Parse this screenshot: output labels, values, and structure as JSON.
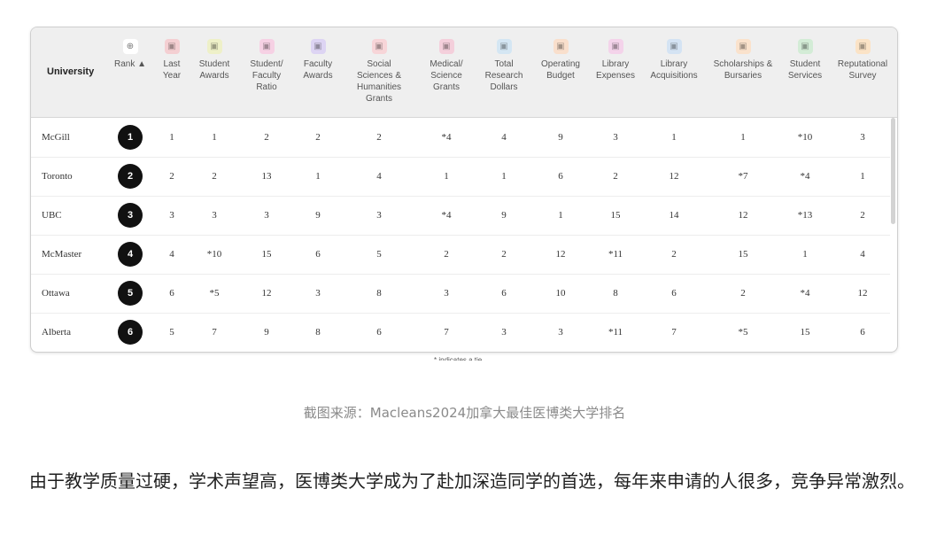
{
  "table": {
    "university_header": "University",
    "columns": [
      {
        "label": "Rank ▲",
        "icon": "sort-icon",
        "color": "#ffffff"
      },
      {
        "label": "Last\nYear",
        "icon": "calendar-icon",
        "color": "#f4cfd2"
      },
      {
        "label": "Student\nAwards",
        "icon": "award-icon",
        "color": "#eef0c8"
      },
      {
        "label": "Student/\nFaculty\nRatio",
        "icon": "people-icon",
        "color": "#f6d1e4"
      },
      {
        "label": "Faculty\nAwards",
        "icon": "medal-icon",
        "color": "#ddd4f3"
      },
      {
        "label": "Social\nSciences &\nHumanities\nGrants",
        "icon": "grant-icon",
        "color": "#f7d5d8"
      },
      {
        "label": "Medical/\nScience\nGrants",
        "icon": "atom-icon",
        "color": "#f4cfdb"
      },
      {
        "label": "Total\nResearch\nDollars",
        "icon": "magnifier-icon",
        "color": "#d4e6f3"
      },
      {
        "label": "Operating\nBudget",
        "icon": "budget-icon",
        "color": "#f9dfcc"
      },
      {
        "label": "Library\nExpenses",
        "icon": "book-icon",
        "color": "#f4d3ea"
      },
      {
        "label": "Library\nAcquisitions",
        "icon": "library-icon",
        "color": "#d4e3f3"
      },
      {
        "label": "Scholarships &\nBursaries",
        "icon": "scholarship-icon",
        "color": "#fae2cc"
      },
      {
        "label": "Student\nServices",
        "icon": "student-icon",
        "color": "#d3ecd6"
      },
      {
        "label": "Reputational\nSurvey",
        "icon": "survey-icon",
        "color": "#fbe3c6"
      }
    ],
    "rows": [
      {
        "university": "McGill",
        "rank": "1",
        "values": [
          "1",
          "1",
          "2",
          "2",
          "2",
          "*4",
          "4",
          "9",
          "3",
          "1",
          "1",
          "*10",
          "3"
        ]
      },
      {
        "university": "Toronto",
        "rank": "2",
        "values": [
          "2",
          "2",
          "13",
          "1",
          "4",
          "1",
          "1",
          "6",
          "2",
          "12",
          "*7",
          "*4",
          "1"
        ]
      },
      {
        "university": "UBC",
        "rank": "3",
        "values": [
          "3",
          "3",
          "3",
          "9",
          "3",
          "*4",
          "9",
          "1",
          "15",
          "14",
          "12",
          "*13",
          "2"
        ]
      },
      {
        "university": "McMaster",
        "rank": "4",
        "values": [
          "4",
          "*10",
          "15",
          "6",
          "5",
          "2",
          "2",
          "12",
          "*11",
          "2",
          "15",
          "1",
          "4"
        ]
      },
      {
        "university": "Ottawa",
        "rank": "5",
        "values": [
          "6",
          "*5",
          "12",
          "3",
          "8",
          "3",
          "6",
          "10",
          "8",
          "6",
          "2",
          "*4",
          "12"
        ]
      },
      {
        "university": "Alberta",
        "rank": "6",
        "values": [
          "5",
          "7",
          "9",
          "8",
          "6",
          "7",
          "3",
          "3",
          "*11",
          "7",
          "*5",
          "15",
          "6"
        ]
      }
    ],
    "footnote": "* indicates a tie"
  },
  "caption": "截图来源：Macleans2024加拿大最佳医博类大学排名",
  "paragraph": "由于教学质量过硬，学术声望高，医博类大学成为了赴加深造同学的首选，每年来申请的人很多，竞争异常激烈。"
}
